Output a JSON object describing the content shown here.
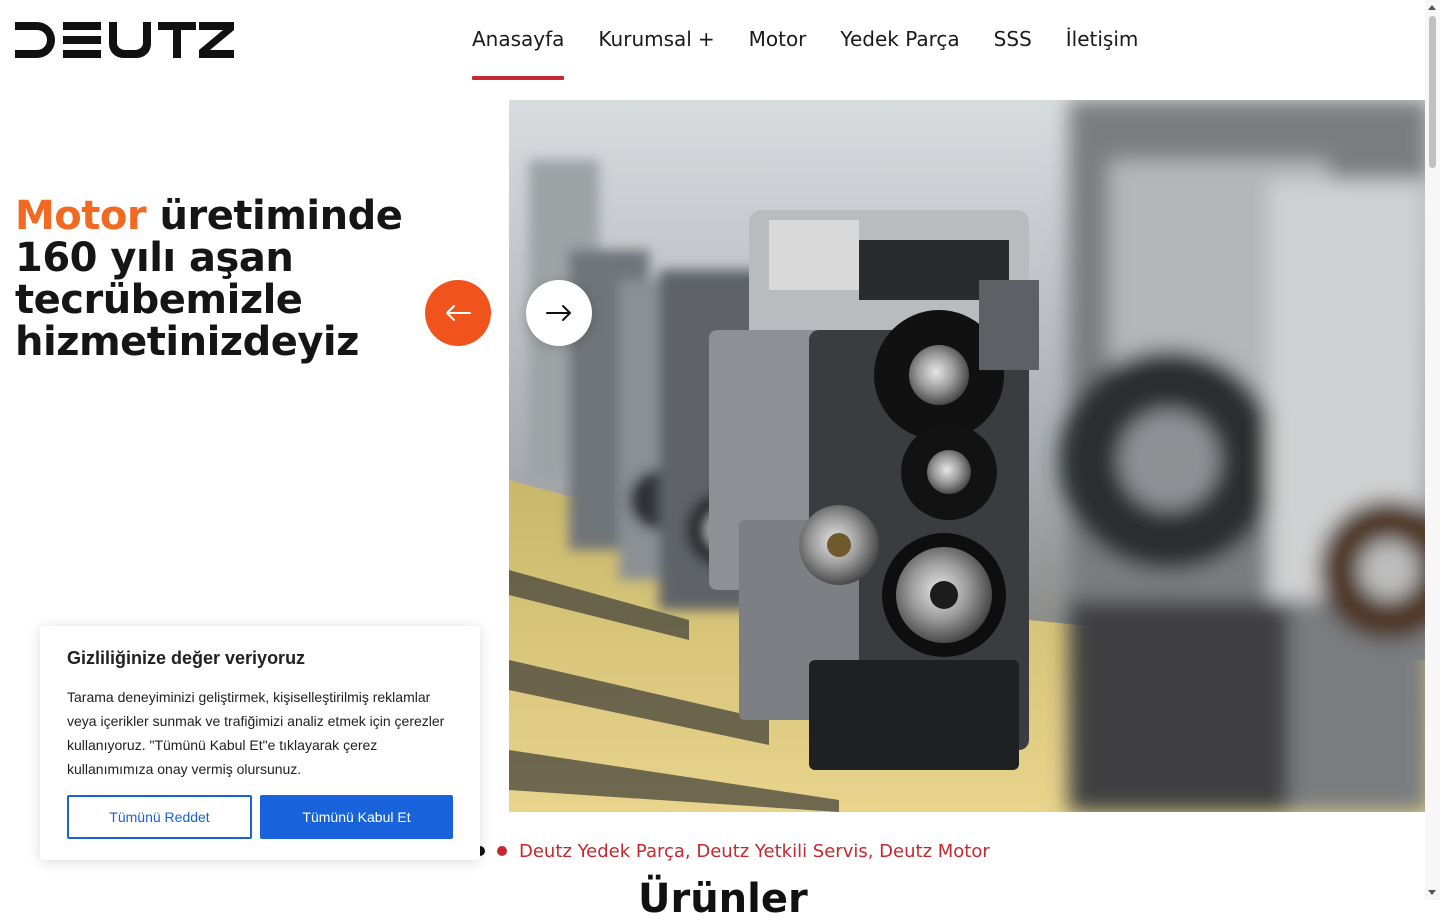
{
  "header": {
    "logo_text": "DEUTZ",
    "nav": [
      {
        "label": "Anasayfa",
        "active": true
      },
      {
        "label": "Kurumsal",
        "has_submenu": true,
        "submenu_icon": "plus"
      },
      {
        "label": "Motor"
      },
      {
        "label": "Yedek Parça"
      },
      {
        "label": "SSS"
      },
      {
        "label": "İletişim"
      }
    ],
    "submenu_symbol": "+"
  },
  "hero": {
    "title_highlight": "Motor",
    "title_rest": " üretiminde 160 yılı aşan tecrübemizle hizmetinizdeyiz",
    "prev_icon": "arrow-left-icon",
    "next_icon": "arrow-right-icon",
    "image_subject": "engine-assembly-line-photo"
  },
  "tags_line": {
    "text": "Deutz Yedek Parça, Deutz Yetkili Servis, Deutz Motor"
  },
  "section_peek": "Ürünler",
  "cookie": {
    "title": "Gizliliğinize değer veriyoruz",
    "body": "Tarama deneyiminizi geliştirmek, kişiselleştirilmiş reklamlar veya içerikler sunmak ve trafiğimizi analiz etmek için çerezler kullanıyoruz. \"Tümünü Kabul Et\"e tıklayarak çerez kullanımımıza onay vermiş olursunuz.",
    "reject_label": "Tümünü Reddet",
    "accept_label": "Tümünü Kabul Et"
  },
  "colors": {
    "accent_orange": "#f26a21",
    "arrow_orange": "#f0531c",
    "brand_red": "#c5282f",
    "cookie_blue": "#1863dc"
  }
}
